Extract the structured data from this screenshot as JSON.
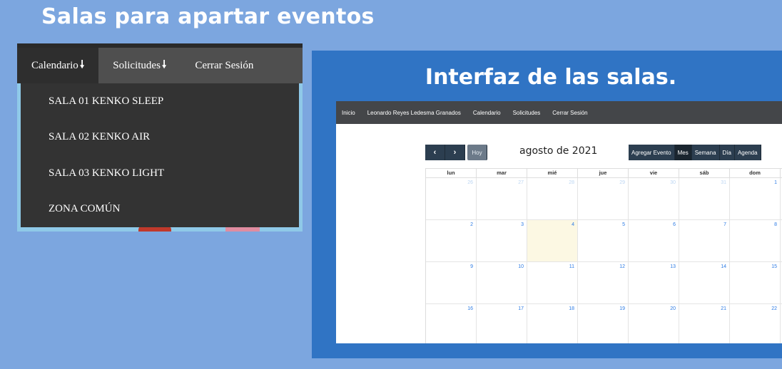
{
  "slide": {
    "title": "Salas para apartar eventos"
  },
  "menu": {
    "tabs": [
      {
        "label": "Calendario",
        "arrow": "🠗"
      },
      {
        "label": "Solicitudes",
        "arrow": "🠗"
      },
      {
        "label": "Cerrar Sesión",
        "arrow": ""
      }
    ],
    "dropdown_items": [
      "SALA 01 KENKO SLEEP",
      "SALA 02 KENKO AIR",
      "SALA 03 KENKO LIGHT",
      "ZONA COMÚN"
    ]
  },
  "interface": {
    "heading": "Interfaz de las salas.",
    "nav": [
      "Inicio",
      "Leonardo Reyes Ledesma Granados",
      "Calendario",
      "Solicitudes",
      "Cerrar Sesión"
    ],
    "toolbar": {
      "prev": "‹",
      "next": "›",
      "today": "Hoy",
      "month_title": "agosto de 2021",
      "add_event": "Agregar Evento",
      "views": [
        "Mes",
        "Semana",
        "Día",
        "Agenda"
      ],
      "active_view": "Mes"
    },
    "weekdays": [
      "lun",
      "mar",
      "mié",
      "jue",
      "vie",
      "sáb",
      "dom"
    ],
    "weeks": [
      [
        "26",
        "27",
        "28",
        "29",
        "30",
        "31",
        "1"
      ],
      [
        "2",
        "3",
        "4",
        "5",
        "6",
        "7",
        "8"
      ],
      [
        "9",
        "10",
        "11",
        "12",
        "13",
        "14",
        "15"
      ],
      [
        "16",
        "17",
        "18",
        "19",
        "20",
        "21",
        "22"
      ]
    ],
    "other_month_days": [
      "26",
      "27",
      "28",
      "29",
      "30",
      "31"
    ],
    "today": "4",
    "colors": {
      "page_bg": "#7ca6df",
      "panel_bg": "#3074c4",
      "nav_bg": "#444649",
      "button_bg": "#2c3e50",
      "today_bg": "#fcf8e3",
      "day_number": "#2c7be5"
    }
  }
}
